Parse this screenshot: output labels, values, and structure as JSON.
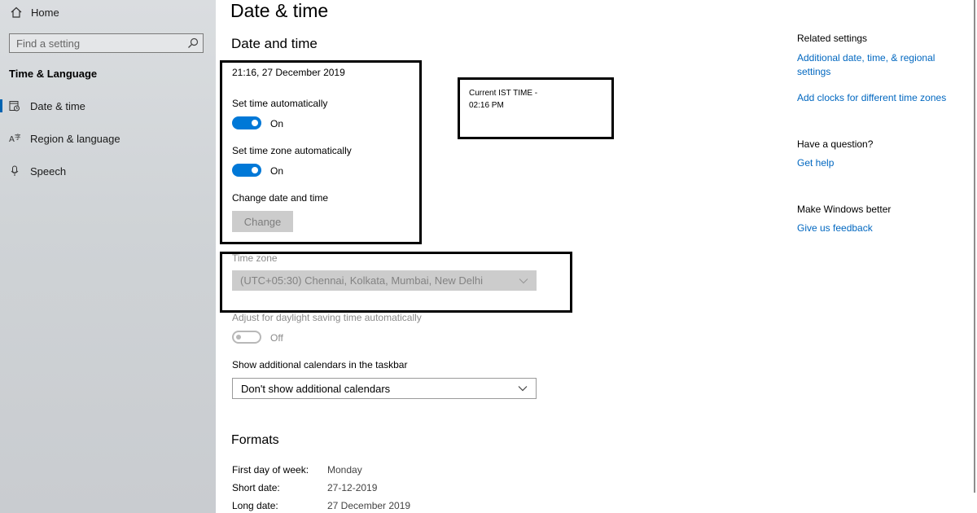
{
  "sidebar": {
    "home": "Home",
    "search_placeholder": "Find a setting",
    "section": "Time & Language",
    "items": [
      {
        "label": "Date & time",
        "icon": "date-time-icon"
      },
      {
        "label": "Region & language",
        "icon": "region-language-icon"
      },
      {
        "label": "Speech",
        "icon": "microphone-icon"
      }
    ]
  },
  "main": {
    "title": "Date & time",
    "section_title": "Date and time",
    "current_datetime": "21:16, 27 December 2019",
    "set_time_auto": {
      "label": "Set time automatically",
      "state": "On"
    },
    "set_tz_auto": {
      "label": "Set time zone automatically",
      "state": "On"
    },
    "change_datetime": {
      "label": "Change date and time",
      "button": "Change"
    },
    "timezone": {
      "label": "Time zone",
      "value": "(UTC+05:30) Chennai, Kolkata, Mumbai, New Delhi"
    },
    "daylight": {
      "label": "Adjust for daylight saving time automatically",
      "state": "Off"
    },
    "calendars": {
      "label": "Show additional calendars in the taskbar",
      "value": "Don't show additional calendars"
    },
    "formats": {
      "title": "Formats",
      "rows": [
        {
          "label": "First day of week:",
          "value": "Monday"
        },
        {
          "label": "Short date:",
          "value": "27-12-2019"
        },
        {
          "label": "Long date:",
          "value": "27 December 2019"
        }
      ]
    }
  },
  "annotation": {
    "line1": "Current IST TIME -",
    "line2": "02:16 PM"
  },
  "related": {
    "title": "Related settings",
    "link1": "Additional date, time, & regional settings",
    "link2": "Add clocks for different time zones",
    "question_title": "Have a question?",
    "help_link": "Get help",
    "better_title": "Make Windows better",
    "feedback_link": "Give us feedback"
  },
  "colors": {
    "accent": "#0078d7",
    "link": "#0067c0",
    "sidebar_bg": "#d2d5d8"
  }
}
